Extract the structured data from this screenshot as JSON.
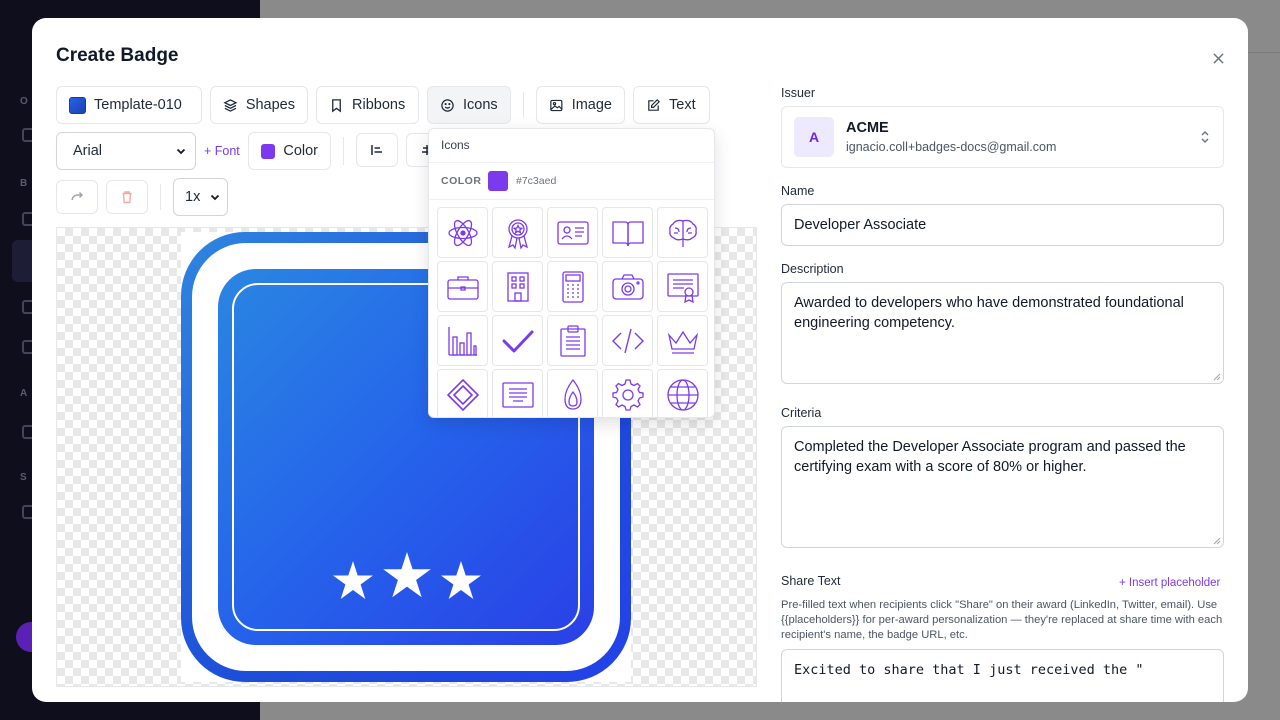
{
  "modal": {
    "title": "Create Badge"
  },
  "toolbar": {
    "template_label": "Template-010",
    "shapes_label": "Shapes",
    "ribbons_label": "Ribbons",
    "icons_label": "Icons",
    "image_label": "Image",
    "text_label": "Text",
    "font_value": "Arial",
    "add_font_label": "+ Font",
    "color_label": "Color",
    "color_value": "#7c3aed",
    "scale_value": "1x"
  },
  "icons_popover": {
    "title": "Icons",
    "color_label": "COLOR",
    "color_hex": "#7c3aed",
    "icons": [
      "atom-icon",
      "award-ribbon-icon",
      "id-card-icon",
      "open-book-icon",
      "brain-icon",
      "briefcase-icon",
      "building-icon",
      "calculator-icon",
      "camera-icon",
      "certificate-icon",
      "bar-chart-icon",
      "checkmark-icon",
      "clipboard-icon",
      "code-icon",
      "crown-icon",
      "diamond-icon",
      "document-lines-icon",
      "flame-icon",
      "gear-icon",
      "globe-icon"
    ]
  },
  "badge_preview": {
    "gradient_start": "#2f86e0",
    "gradient_end": "#2342e8",
    "stars": 3
  },
  "form": {
    "issuer_label": "Issuer",
    "issuer_initial": "A",
    "issuer_name": "ACME",
    "issuer_email": "ignacio.coll+badges-docs@gmail.com",
    "name_label": "Name",
    "name_value": "Developer Associate",
    "description_label": "Description",
    "description_value": "Awarded to developers who have demonstrated foundational engineering competency.",
    "criteria_label": "Criteria",
    "criteria_value": "Completed the Developer Associate program and passed the certifying exam with a score of 80% or higher.",
    "share_label": "Share Text",
    "insert_placeholder_label": "+ Insert placeholder",
    "share_help": "Pre-filled text when recipients click \"Share\" on their award (LinkedIn, Twitter, email). Use {{placeholders}} for per-award personalization — they're replaced at share time with each recipient's name, the badge URL, etc.",
    "share_value": "Excited to share that I just received the \""
  },
  "colors": {
    "accent": "#7c3aed",
    "badge_blue": "#2563eb"
  }
}
